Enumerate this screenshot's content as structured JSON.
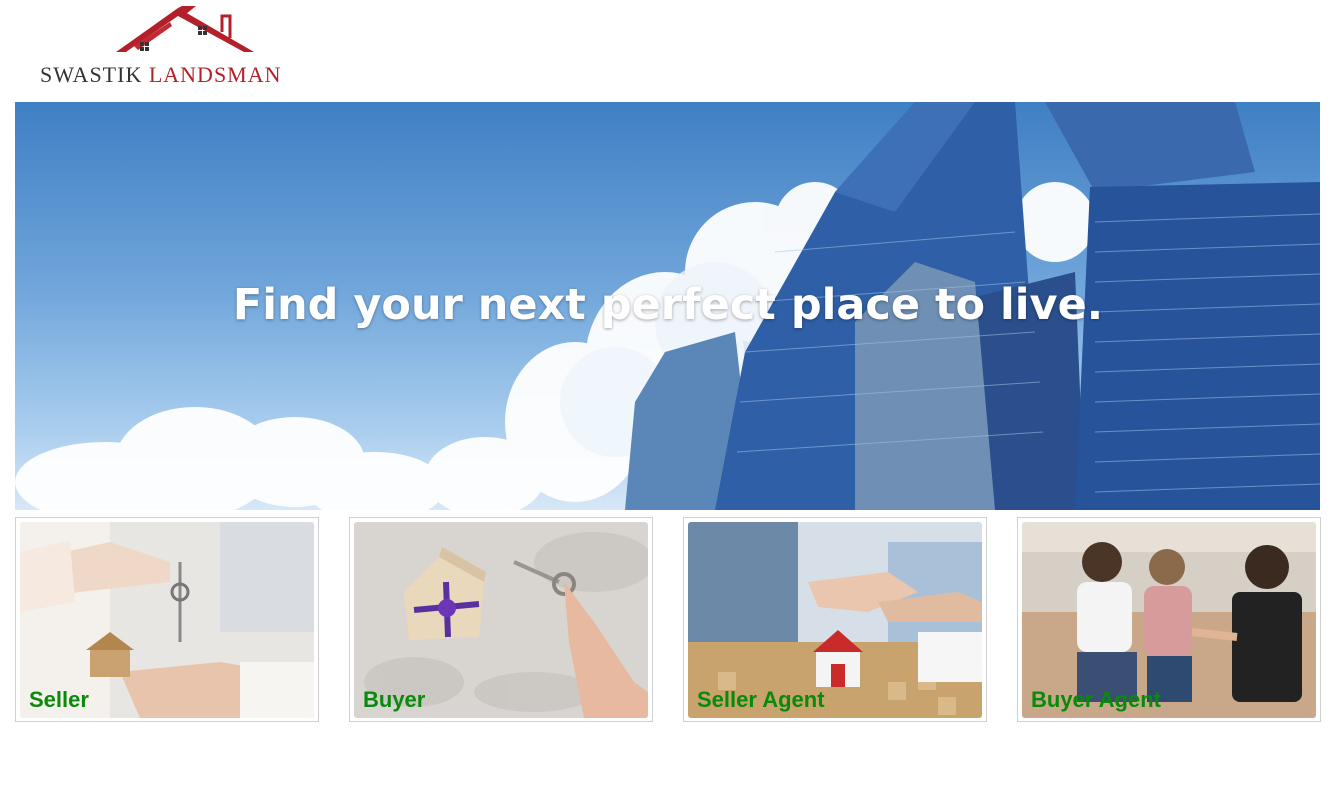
{
  "brand": {
    "name_part1": "SWASTIK",
    "name_part2": "LANDSMAN",
    "logo_icon": "house-roof-icon",
    "colors": {
      "roof": "#b4202a",
      "text_dark": "#333333",
      "text_accent": "#b4202a"
    }
  },
  "hero": {
    "title": "Find your next perfect place to live."
  },
  "cards": [
    {
      "label": "Seller"
    },
    {
      "label": "Buyer"
    },
    {
      "label": "Seller Agent"
    },
    {
      "label": "Buyer Agent"
    }
  ],
  "colors": {
    "card_label": "#0a8a0a"
  }
}
